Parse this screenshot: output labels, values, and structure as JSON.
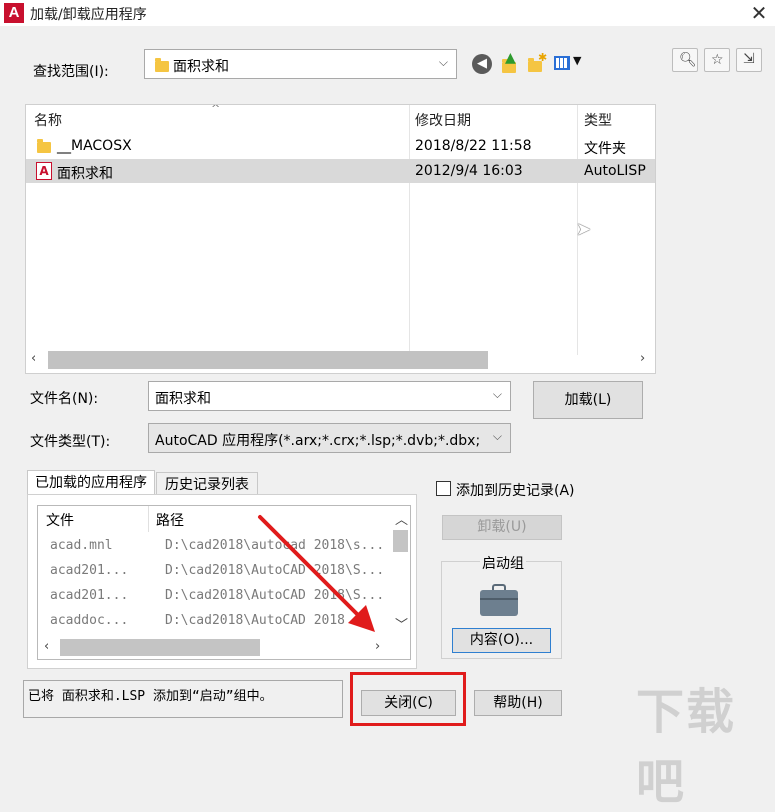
{
  "window": {
    "title": "加载/卸载应用程序",
    "app_icon_letter": "A"
  },
  "lookin": {
    "label": "查找范围(I):",
    "value": "面积求和"
  },
  "filelist": {
    "columns": [
      "名称",
      "修改日期",
      "类型"
    ],
    "rows": [
      {
        "name": "__MACOSX",
        "date": "2018/8/22 11:58",
        "type": "文件夹",
        "icon": "folder-icon"
      },
      {
        "name": "面积求和",
        "date": "2012/9/4 16:03",
        "type": "AutoLISP",
        "icon": "autocad-file-icon"
      }
    ]
  },
  "filename": {
    "label": "文件名(N):",
    "value": "面积求和"
  },
  "filetype": {
    "label": "文件类型(T):",
    "value": "AutoCAD 应用程序(*.arx;*.crx;*.lsp;*.dvb;*.dbx;"
  },
  "load_button": "加载(L)",
  "tabs": [
    "已加载的应用程序",
    "历史记录列表"
  ],
  "apps": {
    "columns": [
      "文件",
      "路径"
    ],
    "rows": [
      {
        "file": "acad.mnl",
        "path": "D:\\cad2018\\autocad 2018\\s..."
      },
      {
        "file": "acad201...",
        "path": "D:\\cad2018\\AutoCAD 2018\\S..."
      },
      {
        "file": "acad201...",
        "path": "D:\\cad2018\\AutoCAD 2018\\S..."
      },
      {
        "file": "acaddoc...",
        "path": "D:\\cad2018\\AutoCAD 2018"
      }
    ]
  },
  "add_history": {
    "label": "添加到历史记录(A)",
    "checked": false
  },
  "unload_button": "卸载(U)",
  "startup": {
    "label": "启动组",
    "contents_button": "内容(O)..."
  },
  "status_text": "已将 面积求和.LSP 添加到“启动”组中。",
  "close_button": "关闭(C)",
  "help_button": "帮助(H)",
  "watermark": "下载吧",
  "colors": {
    "highlight_red": "#e01b1b",
    "selected_row": "#d9d9d9",
    "brand_red": "#c8102e"
  }
}
